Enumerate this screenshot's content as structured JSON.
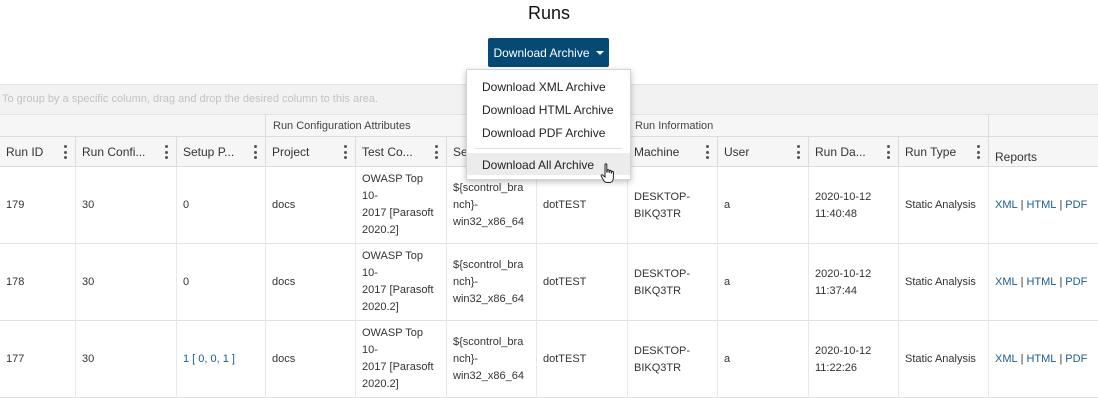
{
  "page": {
    "title": "Runs"
  },
  "toolbar": {
    "download_label": "Download Archive"
  },
  "menu": {
    "items": [
      "Download XML Archive",
      "Download HTML Archive",
      "Download PDF Archive",
      "Download All Archive"
    ]
  },
  "group_bar": {
    "hint": "To group by a specific column, drag and drop the desired column to this area."
  },
  "header_groups": [
    "Run Configuration Attributes",
    "Run Information"
  ],
  "columns": [
    "Run ID",
    "Run Confi...",
    "Setup P...",
    "Project",
    "Test Co...",
    "Se",
    "",
    "Machine",
    "User",
    "Run Da...",
    "Run Type",
    "Reports"
  ],
  "rows": [
    {
      "run_id": "179",
      "run_config": "30",
      "setup": "0",
      "setup_link": false,
      "project": "docs",
      "test_config": [
        "OWASP Top",
        "10-",
        "2017 [Parasoft",
        "2020.2]"
      ],
      "session": [
        "${scontrol_bra",
        "nch}-",
        "win32_x86_64"
      ],
      "tool": "dotTEST",
      "machine": [
        "DESKTOP-",
        "BIKQ3TR"
      ],
      "user": "a",
      "run_date": [
        "2020-10-12",
        "11:40:48"
      ],
      "run_type": "Static Analysis",
      "reports": [
        "XML",
        "HTML",
        "PDF"
      ]
    },
    {
      "run_id": "178",
      "run_config": "30",
      "setup": "0",
      "setup_link": false,
      "project": "docs",
      "test_config": [
        "OWASP Top",
        "10-",
        "2017 [Parasoft",
        "2020.2]"
      ],
      "session": [
        "${scontrol_bra",
        "nch}-",
        "win32_x86_64"
      ],
      "tool": "dotTEST",
      "machine": [
        "DESKTOP-",
        "BIKQ3TR"
      ],
      "user": "a",
      "run_date": [
        "2020-10-12",
        "11:37:44"
      ],
      "run_type": "Static Analysis",
      "reports": [
        "XML",
        "HTML",
        "PDF"
      ]
    },
    {
      "run_id": "177",
      "run_config": "30",
      "setup": "1 [ 0, 0, 1 ]",
      "setup_link": true,
      "project": "docs",
      "test_config": [
        "OWASP Top",
        "10-",
        "2017 [Parasoft",
        "2020.2]"
      ],
      "session": [
        "${scontrol_bra",
        "nch}-",
        "win32_x86_64"
      ],
      "tool": "dotTEST",
      "machine": [
        "DESKTOP-",
        "BIKQ3TR"
      ],
      "user": "a",
      "run_date": [
        "2020-10-12",
        "11:22:26"
      ],
      "run_type": "Static Analysis",
      "reports": [
        "XML",
        "HTML",
        "PDF"
      ]
    }
  ],
  "colors": {
    "button": "#044a75",
    "link": "#1a5d94",
    "header_bg": "#f6f6f6"
  }
}
